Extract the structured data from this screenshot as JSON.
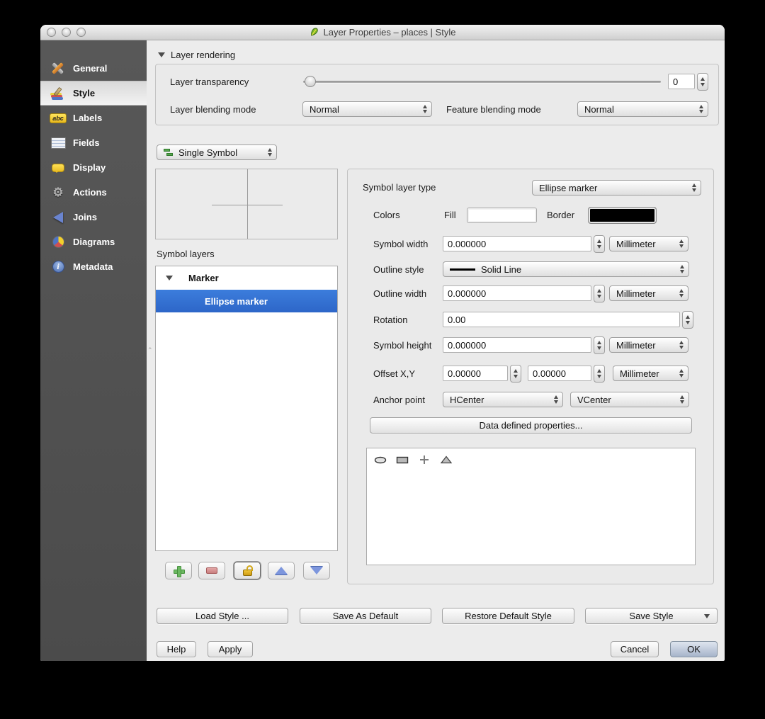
{
  "window": {
    "title": "Layer Properties – places | Style"
  },
  "sidebar": {
    "items": [
      {
        "label": "General"
      },
      {
        "label": "Style"
      },
      {
        "label": "Labels"
      },
      {
        "label": "Fields"
      },
      {
        "label": "Display"
      },
      {
        "label": "Actions"
      },
      {
        "label": "Joins"
      },
      {
        "label": "Diagrams"
      },
      {
        "label": "Metadata"
      }
    ],
    "labels_icon_text": "abc"
  },
  "layer_rendering": {
    "header": "Layer rendering",
    "transparency_label": "Layer transparency",
    "transparency_value": "0",
    "layer_blending_label": "Layer blending mode",
    "layer_blending_value": "Normal",
    "feature_blending_label": "Feature blending mode",
    "feature_blending_value": "Normal"
  },
  "renderer": {
    "value": "Single Symbol"
  },
  "symbol_layers": {
    "label": "Symbol layers",
    "group_label": "Marker",
    "selected_layer": "Ellipse marker"
  },
  "properties": {
    "symbol_layer_type": {
      "label": "Symbol layer type",
      "value": "Ellipse marker"
    },
    "colors": {
      "label": "Colors",
      "fill_label": "Fill",
      "fill_color": "#ffffff",
      "border_label": "Border",
      "border_color": "#000000"
    },
    "symbol_width": {
      "label": "Symbol width",
      "value": "0.000000",
      "unit": "Millimeter"
    },
    "outline_style": {
      "label": "Outline style",
      "value": "Solid Line"
    },
    "outline_width": {
      "label": "Outline width",
      "value": "0.000000",
      "unit": "Millimeter"
    },
    "rotation": {
      "label": "Rotation",
      "value": "0.00"
    },
    "symbol_height": {
      "label": "Symbol height",
      "value": "0.000000",
      "unit": "Millimeter"
    },
    "offset": {
      "label": "Offset X,Y",
      "x_value": "0.00000",
      "y_value": "0.00000",
      "unit": "Millimeter"
    },
    "anchor": {
      "label": "Anchor point",
      "h_value": "HCenter",
      "v_value": "VCenter"
    },
    "data_defined_button": "Data defined properties..."
  },
  "style_buttons": {
    "load": "Load Style ...",
    "save_default": "Save As Default",
    "restore_default": "Restore Default Style",
    "save_style": "Save Style"
  },
  "footer": {
    "help": "Help",
    "apply": "Apply",
    "cancel": "Cancel",
    "ok": "OK"
  }
}
